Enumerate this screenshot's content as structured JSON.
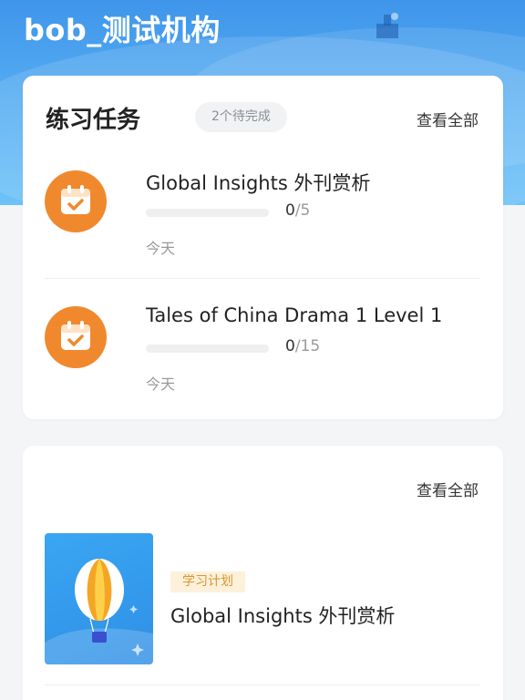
{
  "header": {
    "org_name": "bob_测试机构"
  },
  "practice_tasks": {
    "title": "练习任务",
    "pending_badge": "2个待完成",
    "view_all": "查看全部",
    "tasks": [
      {
        "name": "Global Insights 外刊赏析",
        "completed": "0",
        "total": "/5",
        "progress_fraction": 0,
        "date": "今天",
        "icon": "calendar-check-icon"
      },
      {
        "name": "Tales of China Drama 1 Level 1",
        "completed": "0",
        "total": "/15",
        "progress_fraction": 0,
        "date": "今天",
        "icon": "calendar-check-icon"
      }
    ]
  },
  "study_plans": {
    "view_all": "查看全部",
    "items": [
      {
        "tag": "学习计划",
        "title": "Global Insights 外刊赏析",
        "thumbnail_icon": "hot-air-balloon-illustration"
      }
    ]
  },
  "colors": {
    "header_blue": "#3f95ea",
    "accent_orange": "#f0892e",
    "tag_text": "#d9962f",
    "tag_bg": "#fdf1db"
  }
}
